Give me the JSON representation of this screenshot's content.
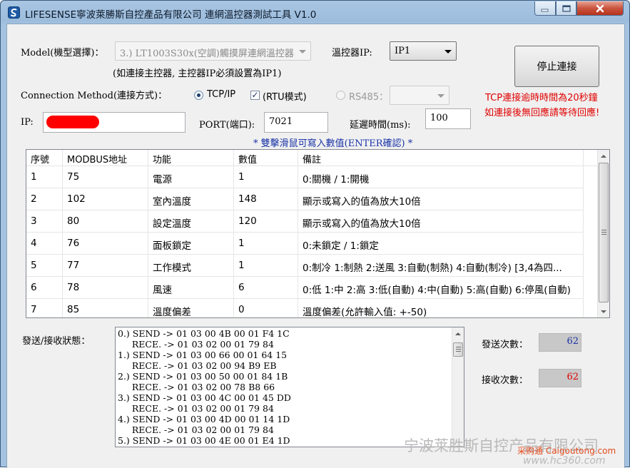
{
  "window": {
    "title": "LIFESENSE寧波萊勝斯自控產品有限公司 連網溫控器測試工具 V1.0",
    "minimize_icon": "minimize-icon",
    "maximize_icon": "maximize-icon",
    "close_icon": "close-icon"
  },
  "form": {
    "model_label": "Model(機型選擇)：",
    "model_value": "3.) LT1003S30x(空調)觸摸屏連網溫控器",
    "model_note": "(如連接主控器, 主控器IP必須設置為IP1)",
    "controller_ip_label": "溫控器IP:",
    "controller_ip_value": "IP1",
    "stop_button": "停止連接",
    "connection_label": "Connection Method(連接方式)：",
    "tcp_label": "TCP/IP",
    "rtu_label": "(RTU模式)",
    "rs485_label": "RS485：",
    "rs485_value": "",
    "ip_label": "IP:",
    "ip_value": "",
    "port_label": "PORT(端口):",
    "port_value": "7021",
    "delay_label": "延遲時間(ms):",
    "delay_value": "100",
    "warning_line1": "TCP連接逾時時間為20秒鐘",
    "warning_line2": "如連接後無回應請等待回應!",
    "hint": "* 雙擊滑鼠可寫入數值(ENTER確認) *"
  },
  "grid": {
    "headers": [
      "序號",
      "MODBUS地址",
      "功能",
      "數值",
      "備註"
    ],
    "rows": [
      [
        "1",
        "75",
        "電源",
        "1",
        "0:關機 / 1:開機"
      ],
      [
        "2",
        "102",
        "室內溫度",
        "148",
        "顯示或寫入的值為放大10倍"
      ],
      [
        "3",
        "80",
        "設定溫度",
        "120",
        "顯示或寫入的值為放大10倍"
      ],
      [
        "4",
        "76",
        "面板鎖定",
        "1",
        "0:未鎖定 / 1:鎖定"
      ],
      [
        "5",
        "77",
        "工作模式",
        "1",
        "0:制冷 1:制熱 2:送風 3:自動(制熱) 4:自動(制冷) [3,4為四..."
      ],
      [
        "6",
        "78",
        "風速",
        "6",
        "0:低 1:中 2:高 3:低(自動) 4:中(自動) 5:高(自動) 6:停風(自動)"
      ],
      [
        "7",
        "85",
        "溫度偏差",
        "0",
        "溫度偏差(允許輸入值: +-50)"
      ]
    ]
  },
  "log": {
    "label": "發送/接收狀態：",
    "lines": [
      "0.) SEND -> 01 03 00 4B 00 01 F4 1C",
      "     RECE. -> 01 03 02 00 01 79 84",
      "1.) SEND -> 01 03 00 66 00 01 64 15",
      "     RECE. -> 01 03 02 00 94 B9 EB",
      "2.) SEND -> 01 03 00 50 00 01 84 1B",
      "     RECE. -> 01 03 02 00 78 B8 66",
      "3.) SEND -> 01 03 00 4C 00 01 45 DD",
      "     RECE. -> 01 03 02 00 01 79 84",
      "4.) SEND -> 01 03 00 4D 00 01 14 1D",
      "     RECE. -> 01 03 02 00 01 79 84",
      "5.) SEND -> 01 03 00 4E 00 01 E4 1D"
    ]
  },
  "counters": {
    "send_label": "發送次數：",
    "send_value": "62",
    "send_color": "#1a33a8",
    "recv_label": "接收次數：",
    "recv_value": "62",
    "recv_color": "#e00000"
  },
  "watermark": {
    "company": "宁波莱胜斯自控产品有限公司",
    "site1": "采购通 Caigoutong.com",
    "site2": "www.hc360.com"
  }
}
